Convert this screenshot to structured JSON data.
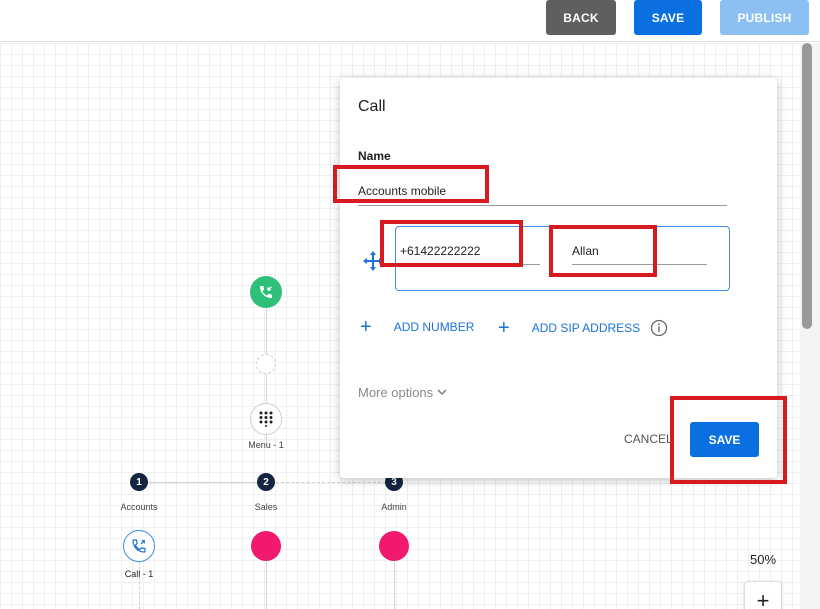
{
  "toolbar": {
    "back_label": "BACK",
    "save_label": "SAVE",
    "publish_label": "PUBLISH"
  },
  "flow": {
    "menu_label": "Menu - 1",
    "branches": [
      {
        "number": "1",
        "label": "Accounts"
      },
      {
        "number": "2",
        "label": "Sales"
      },
      {
        "number": "3",
        "label": "Admin"
      }
    ],
    "call_node_label": "Call - 1"
  },
  "zoom": {
    "level": "50%",
    "plus_label": "+"
  },
  "dialog": {
    "title": "Call",
    "name_label": "Name",
    "name_value": "Accounts mobile",
    "phone_value": "+61422222222",
    "contact_value": "Allan",
    "add_number_label": "ADD NUMBER",
    "add_sip_label": "ADD SIP ADDRESS",
    "more_options_label": "More options",
    "cancel_label": "CANCEL",
    "save_label": "SAVE"
  },
  "colors": {
    "primary": "#0a6fe0",
    "publish_disabled": "#8cc0f2",
    "back": "#5f5f5f",
    "start_node": "#2fbf77",
    "branch_node": "#14263f",
    "pink_node": "#f0186f",
    "highlight": "#d71920"
  },
  "icons": {
    "start": "incoming-call-icon",
    "menu": "dialpad-icon",
    "call": "outgoing-call-icon",
    "drag": "move-arrows-icon",
    "info": "info-icon",
    "more": "chevron-down-icon"
  }
}
